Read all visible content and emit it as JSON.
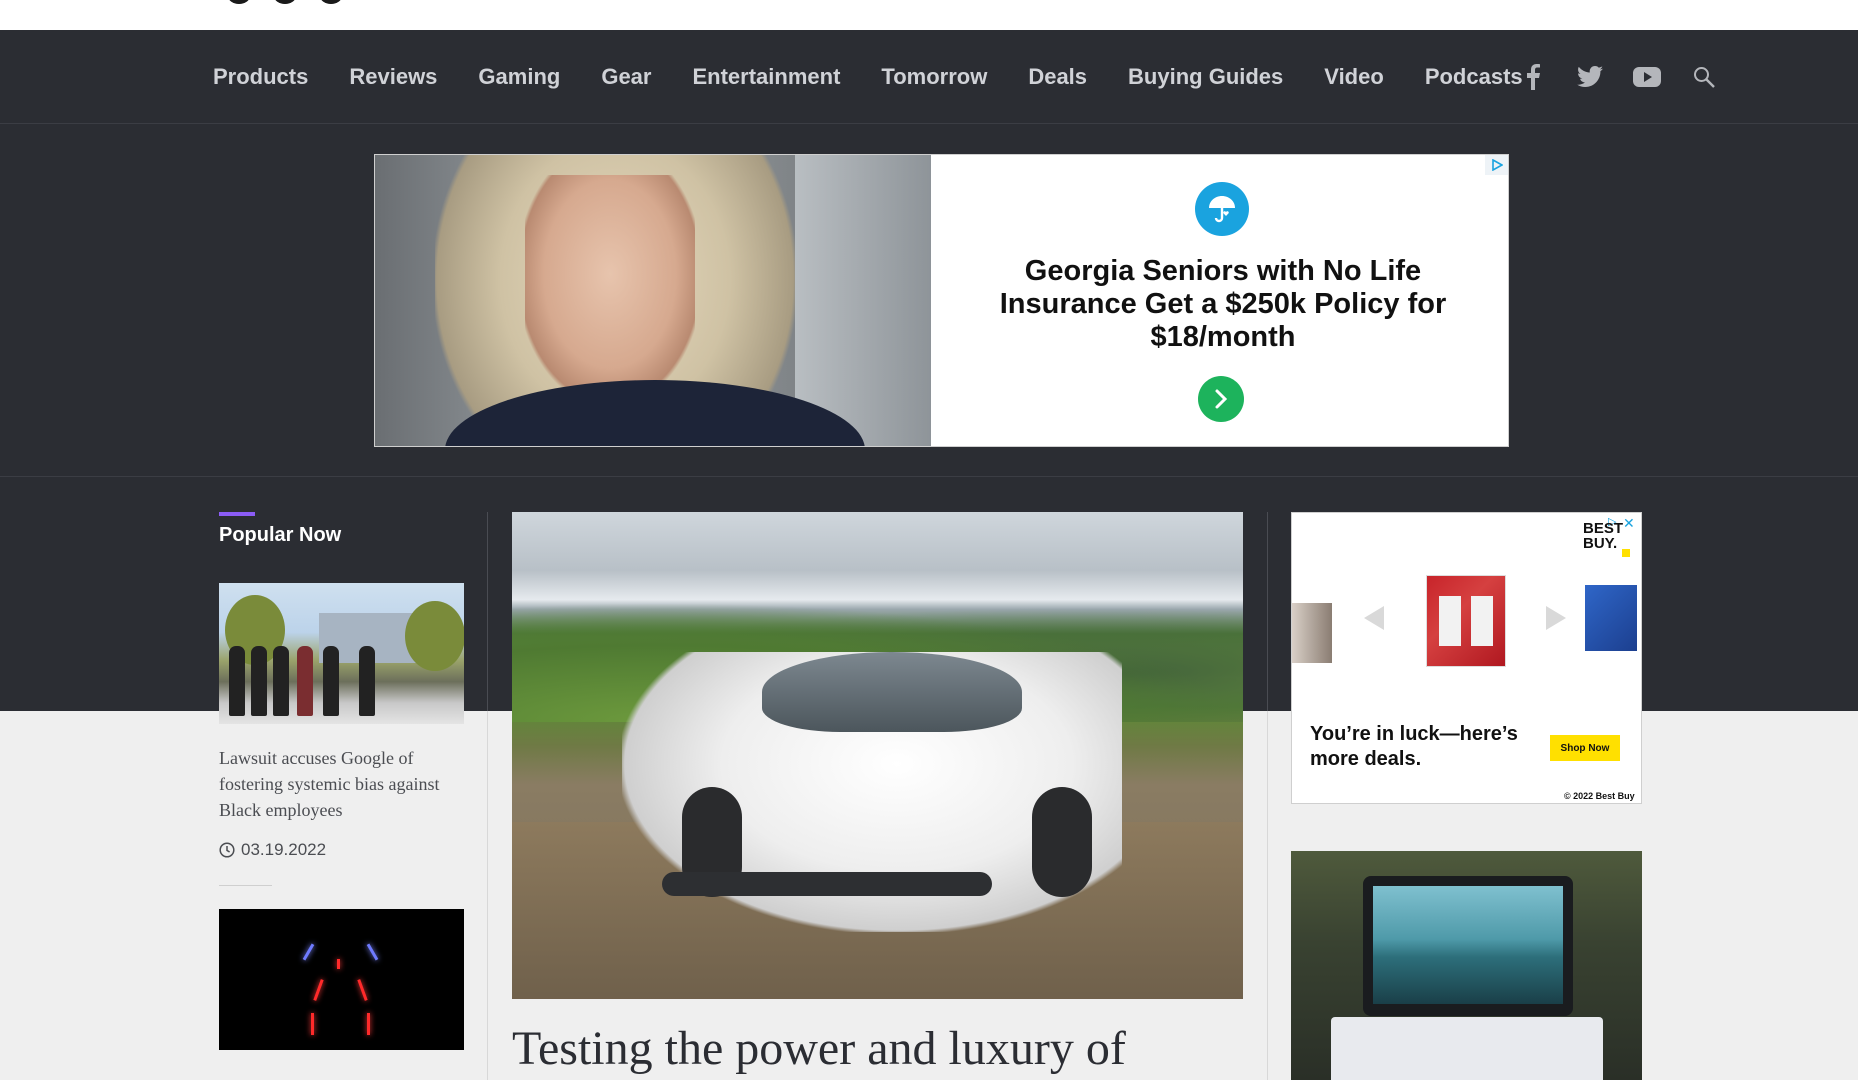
{
  "nav": {
    "items": [
      "Products",
      "Reviews",
      "Gaming",
      "Gear",
      "Entertainment",
      "Tomorrow",
      "Deals",
      "Buying Guides",
      "Video",
      "Podcasts"
    ],
    "icons": [
      "facebook-icon",
      "twitter-icon",
      "youtube-icon",
      "search-icon"
    ]
  },
  "banner_ad": {
    "headline": "Georgia Seniors with No Life Insurance Get a $250k Policy for $18/month"
  },
  "popular": {
    "title": "Popular Now",
    "articles": [
      {
        "title": "Lawsuit accuses Google of fostering systemic bias against Black employees",
        "date": "03.19.2022"
      }
    ]
  },
  "hero": {
    "headline": "Testing the power and luxury of"
  },
  "sidebar_ad": {
    "brand_line1": "BEST",
    "brand_line2": "BUY.",
    "headline": "You’re in luck—here’s more deals.",
    "cta": "Shop Now",
    "copyright": "© 2022 Best Buy"
  },
  "colors": {
    "nav_bg": "#2b2d33",
    "nav_text": "#d0d2d7",
    "accent_purple": "#8b5cf6",
    "ad_cta_green": "#1db35c",
    "shop_yellow": "#ffe000"
  }
}
